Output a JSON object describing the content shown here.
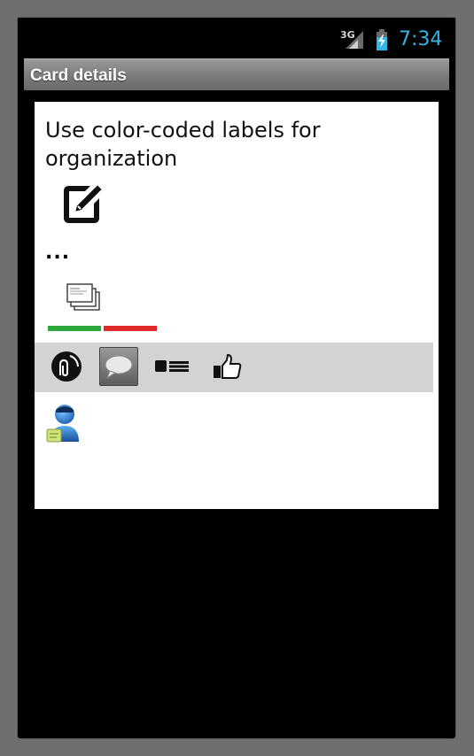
{
  "status_bar": {
    "network": "3G",
    "time": "7:34",
    "signal_icon": "signal-icon",
    "battery_icon": "battery-charging-icon"
  },
  "title_bar": {
    "title": "Card details"
  },
  "card": {
    "title": "Use color-coded labels for organization",
    "edit_icon": "edit-icon",
    "description": "...",
    "card_stack_icon": "card-stack-icon",
    "labels": [
      {
        "color": "#2ea83c"
      },
      {
        "color": "#e02a2a"
      }
    ],
    "toolbar": {
      "items": [
        "attachment-icon",
        "comment-icon",
        "checklist-icon",
        "like-icon"
      ]
    },
    "member_icon": "member-avatar-icon"
  }
}
